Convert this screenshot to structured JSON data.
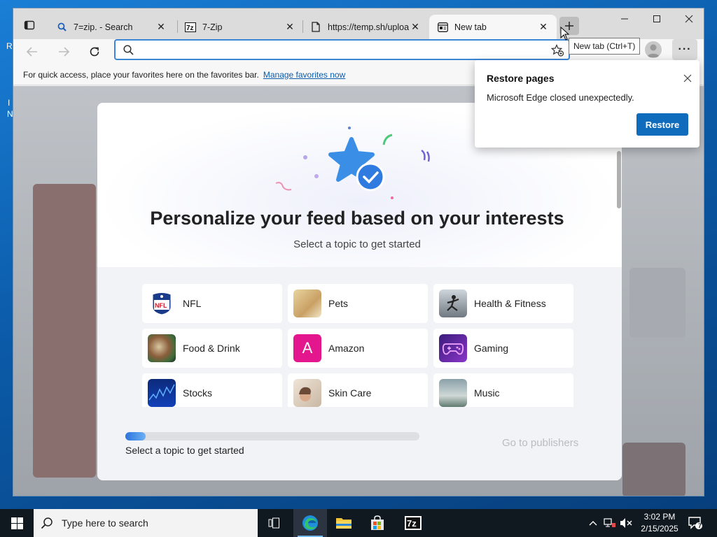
{
  "desktop": {
    "edge_letters": [
      "R",
      "I",
      "N"
    ]
  },
  "tabs": [
    {
      "label": "7=zip. - Search",
      "icon": "search-icon",
      "active": false
    },
    {
      "label": "7-Zip",
      "icon": "7zip-favicon",
      "active": false
    },
    {
      "label": "https://temp.sh/upload",
      "icon": "page-icon",
      "active": false
    },
    {
      "label": "New tab",
      "icon": "newtab-icon",
      "active": true
    }
  ],
  "tooltip": "New tab (Ctrl+T)",
  "addressbar": {
    "value": "",
    "placeholder": ""
  },
  "favorites_bar": {
    "message": "For quick access, place your favorites here on the favorites bar.",
    "link": "Manage favorites now"
  },
  "restore_popup": {
    "title": "Restore pages",
    "message": "Microsoft Edge closed unexpectedly.",
    "button": "Restore"
  },
  "personalize": {
    "title": "Personalize your feed based on your interests",
    "subtitle": "Select a topic to get started",
    "topics": [
      {
        "label": "NFL",
        "icon": "nfl-logo"
      },
      {
        "label": "Pets",
        "icon": "pets-photo"
      },
      {
        "label": "Health & Fitness",
        "icon": "fitness-photo"
      },
      {
        "label": "Food & Drink",
        "icon": "food-photo"
      },
      {
        "label": "Amazon",
        "icon": "amazon-letter",
        "letter": "A"
      },
      {
        "label": "Gaming",
        "icon": "gamepad-photo"
      },
      {
        "label": "Stocks",
        "icon": "stocks-photo"
      },
      {
        "label": "Skin Care",
        "icon": "skincare-photo"
      },
      {
        "label": "Music",
        "icon": "music-photo"
      }
    ],
    "progress_fraction": 0.07,
    "progress_label": "Select a topic to get started",
    "publishers_button": "Go to publishers"
  },
  "taskbar": {
    "search_placeholder": "Type here to search",
    "pinned": [
      "task-view-icon",
      "edge-icon",
      "file-explorer-icon",
      "store-icon",
      "7zip-icon"
    ],
    "active_app": "edge-icon",
    "clock_time": "3:02 PM",
    "clock_date": "2/15/2025",
    "notification_count": "7"
  },
  "colors": {
    "accent": "#0f6cbd",
    "address_focus": "#3c86d6",
    "amazon_tile": "#e3168e",
    "taskbar": "#101820"
  }
}
